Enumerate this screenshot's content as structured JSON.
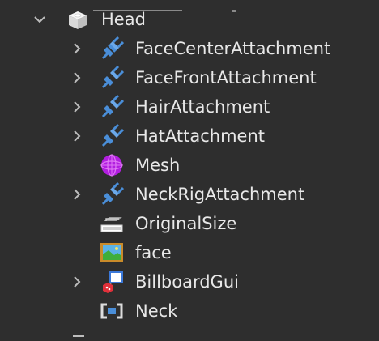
{
  "explorer": {
    "parent": {
      "name": "Head",
      "icon": "part-icon",
      "expanded": true
    },
    "children": [
      {
        "name": "FaceCenterAttachment",
        "icon": "attachment-icon",
        "has_children": true
      },
      {
        "name": "FaceFrontAttachment",
        "icon": "attachment-icon",
        "has_children": true
      },
      {
        "name": "HairAttachment",
        "icon": "attachment-icon",
        "has_children": true
      },
      {
        "name": "HatAttachment",
        "icon": "attachment-icon",
        "has_children": true
      },
      {
        "name": "Mesh",
        "icon": "mesh-icon",
        "has_children": false
      },
      {
        "name": "NeckRigAttachment",
        "icon": "attachment-icon",
        "has_children": true
      },
      {
        "name": "OriginalSize",
        "icon": "vector3-value-icon",
        "has_children": false
      },
      {
        "name": "face",
        "icon": "decal-icon",
        "has_children": false
      },
      {
        "name": "BillboardGui",
        "icon": "billboardgui-icon",
        "has_children": true
      },
      {
        "name": "Neck",
        "icon": "motor6d-icon",
        "has_children": false
      }
    ]
  },
  "colors": {
    "background": "#2e2e2e",
    "text": "#e8e8e8",
    "chevron": "#bdbdbd",
    "attachment_blue": "#4a8ed8",
    "mesh_purple": "#b21ee0"
  }
}
